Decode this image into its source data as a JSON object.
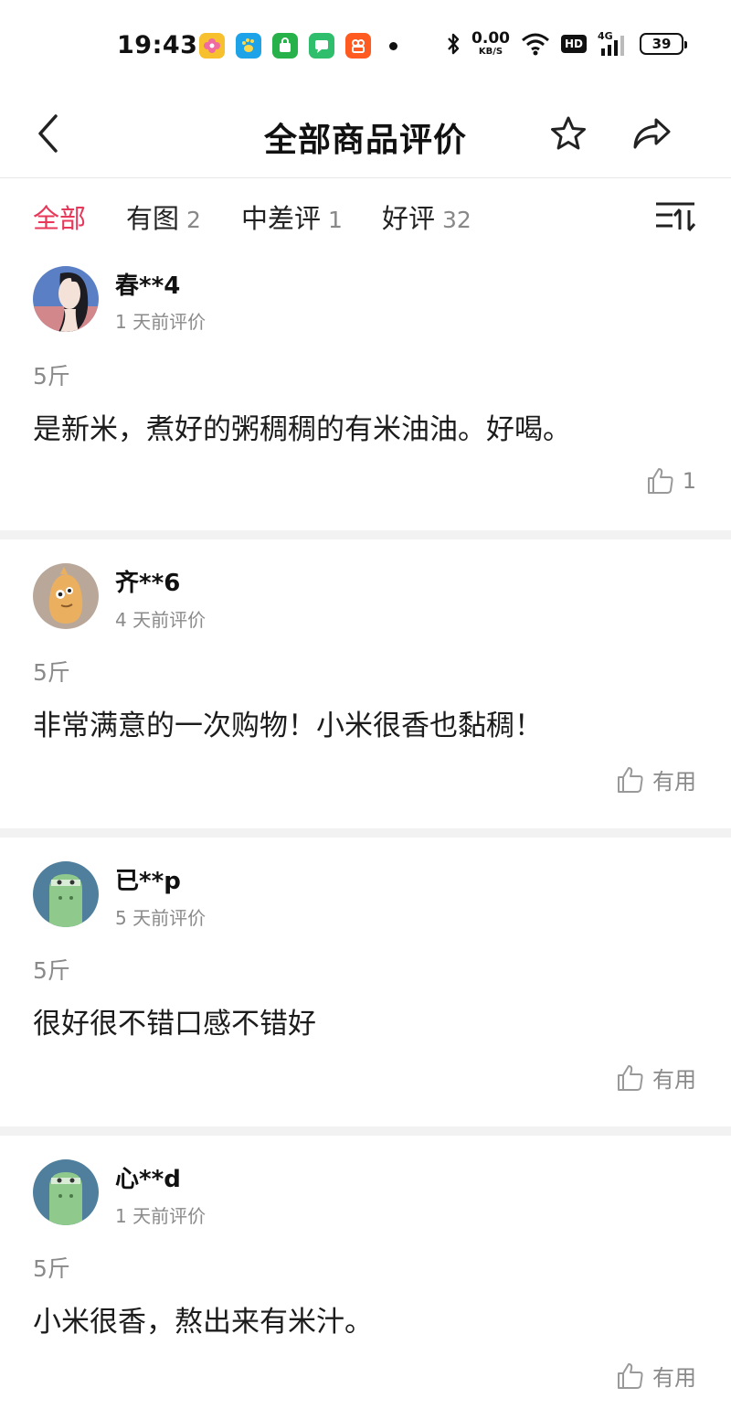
{
  "status_bar": {
    "time": "19:43",
    "net_speed_value": "0.00",
    "net_speed_unit": "KB/S",
    "hd_label": "HD",
    "network_type": "4G",
    "battery_level": "39",
    "app_icons": [
      "flower-app-icon",
      "paw-app-icon",
      "shopping-bag-app-icon",
      "chat-app-icon",
      "kuaishou-app-icon"
    ]
  },
  "header": {
    "title": "全部商品评价"
  },
  "filters": [
    {
      "label": "全部",
      "count": "",
      "active": true
    },
    {
      "label": "有图",
      "count": "2",
      "active": false
    },
    {
      "label": "中差评",
      "count": "1",
      "active": false
    },
    {
      "label": "好评",
      "count": "32",
      "active": false
    }
  ],
  "reviews": [
    {
      "username": "春**4",
      "date": "1 天前评价",
      "spec": "5斤",
      "text": "是新米，煮好的粥稠稠的有米油油。好喝。",
      "like_label": "1",
      "avatar": "woman-portrait-avatar"
    },
    {
      "username": "齐**6",
      "date": "4 天前评价",
      "spec": "5斤",
      "text": "非常满意的一次购物！小米很香也黏稠！",
      "like_label": "有用",
      "avatar": "cartoon-chick-avatar"
    },
    {
      "username": "已**p",
      "date": "5 天前评价",
      "spec": "5斤",
      "text": "很好很不错口感不错好",
      "like_label": "有用",
      "avatar": "green-monster-avatar"
    },
    {
      "username": "心**d",
      "date": "1 天前评价",
      "spec": "5斤",
      "text": "小米很香，熬出来有米汁。",
      "like_label": "有用",
      "avatar": "green-monster-avatar"
    }
  ],
  "colors": {
    "accent": "#e8385a",
    "muted_text": "#8a8a8a",
    "divider": "#f2f2f2"
  }
}
